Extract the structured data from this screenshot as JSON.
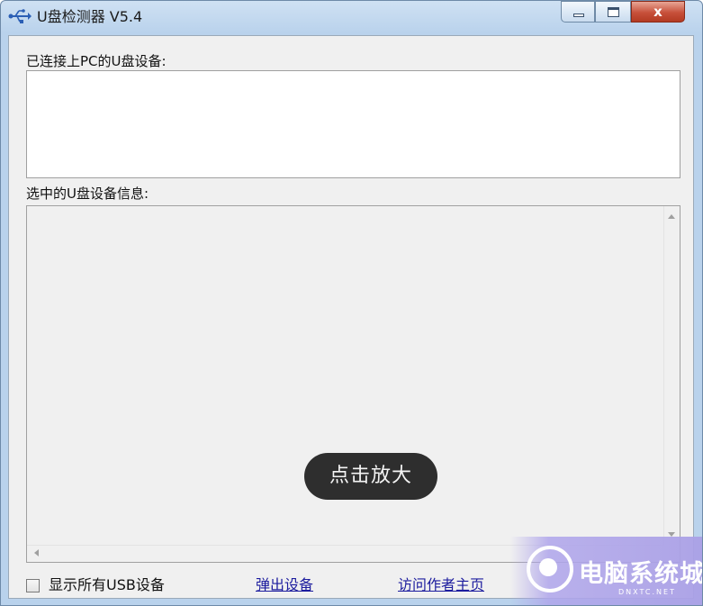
{
  "window": {
    "title": "U盘检测器 V5.4",
    "icon": "usb-icon",
    "controls": {
      "minimize": "minimize-icon",
      "maximize": "maximize-icon",
      "close": "x"
    }
  },
  "main": {
    "connected_label": "已连接上PC的U盘设备:",
    "info_label": "选中的U盘设备信息:",
    "zoom_overlay": "点击放大"
  },
  "footer": {
    "show_all_usb_label": "显示所有USB设备",
    "show_all_usb_checked": false,
    "eject_link": "弹出设备",
    "visit_author_link": "访问作者主页"
  },
  "watermark": {
    "text": "电脑系统城",
    "sub": "DNXTC.NET"
  },
  "colors": {
    "link": "#1c1c9e",
    "close_button": "#c7503a",
    "title_bar": "#b9d2ec",
    "overlay_pill": "#2e2e2e",
    "watermark": "#aaa0e6"
  }
}
